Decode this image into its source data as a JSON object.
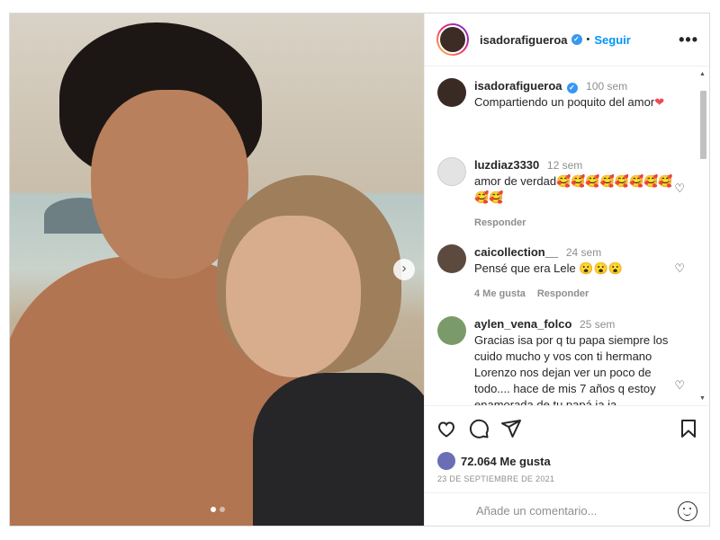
{
  "post": {
    "username": "isadorafigueroa",
    "verified_mark": "✓",
    "separator": "•",
    "follow_label": "Seguir",
    "more_label": "•••",
    "caption": "Compartiendo un poquito del amor",
    "caption_emoji": "❤",
    "caption_time": "100 sem"
  },
  "carousel": {
    "next_arrow": "›",
    "current_slide": 1,
    "total_slides": 2
  },
  "comments": [
    {
      "username": "luzdiaz3330",
      "time": "12 sem",
      "text": "amor de verdad🥰🥰🥰🥰🥰🥰🥰🥰🥰🥰",
      "reply_label": "Responder",
      "likes_label": ""
    },
    {
      "username": "caicollection__",
      "time": "24 sem",
      "text": "Pensé que era Lele 😮😮😮",
      "reply_label": "Responder",
      "likes_label": "4 Me gusta"
    },
    {
      "username": "aylen_vena_folco",
      "time": "25 sem",
      "text": "Gracias isa por q tu papa siempre los cuido mucho y vos con ti hermano Lorenzo nos dejan ver un poco de todo.... hace de mis 7 años q estoy enamorada de tu papá ja ja",
      "reply_label": "",
      "likes_label": ""
    }
  ],
  "stats": {
    "likes": "72.064 Me gusta",
    "date": "23 DE SEPTIEMBRE DE 2021"
  },
  "add_comment": {
    "placeholder": "Añade un comentario..."
  },
  "scroll": {
    "up": "▲",
    "down": "▼"
  },
  "icons": {
    "heart": "heart-icon",
    "comment": "comment-icon",
    "share": "share-icon",
    "save": "bookmark-icon",
    "emoji": "emoji-icon"
  },
  "colors": {
    "accent": "#0095f6",
    "verified": "#3897f0",
    "like_red": "#ed4956"
  }
}
